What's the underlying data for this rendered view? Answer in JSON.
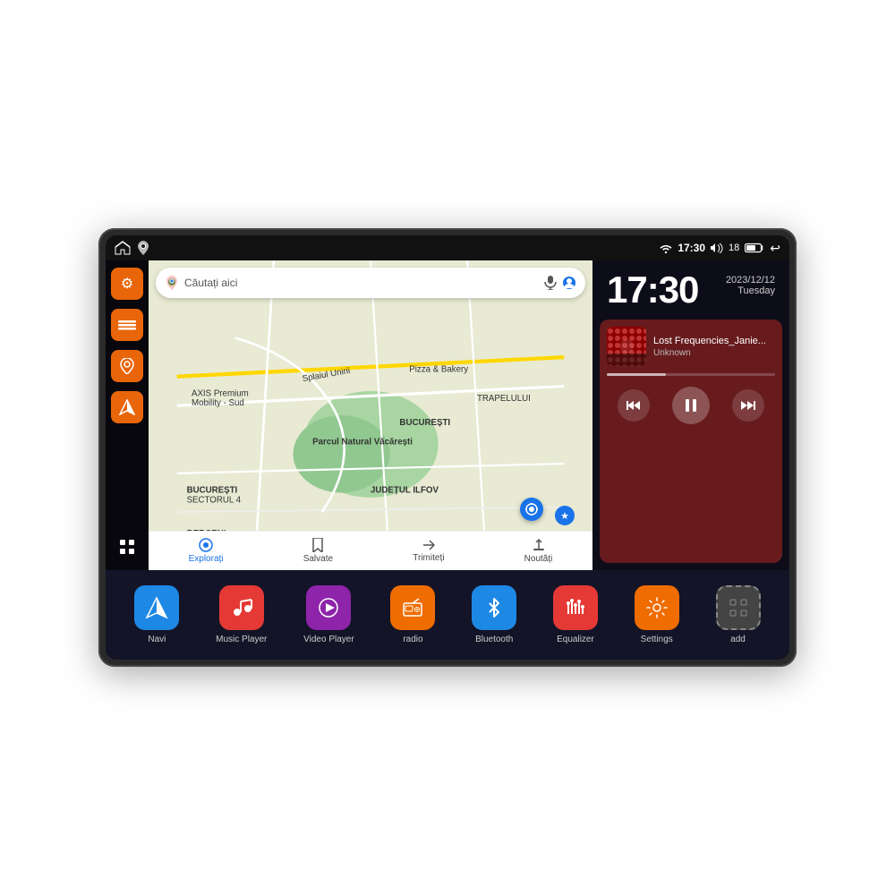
{
  "device": {
    "title": "Car Android Head Unit"
  },
  "status_bar": {
    "wifi_icon": "▼",
    "time": "17:30",
    "volume_icon": "🔊",
    "battery_level": "18",
    "battery_icon": "🔋",
    "back_icon": "↩"
  },
  "sidebar": {
    "icons": [
      {
        "id": "settings",
        "label": "Settings",
        "icon": "⚙",
        "color": "orange"
      },
      {
        "id": "files",
        "label": "Files",
        "icon": "≡",
        "color": "orange"
      },
      {
        "id": "maps",
        "label": "Maps",
        "icon": "📍",
        "color": "orange"
      },
      {
        "id": "navigation",
        "label": "Navigation",
        "icon": "▲",
        "color": "orange"
      }
    ],
    "dots_icon": "⠿"
  },
  "map": {
    "search_placeholder": "Căutați aici",
    "bottom_items": [
      {
        "id": "explore",
        "label": "Explorați",
        "icon": "🔍",
        "active": true
      },
      {
        "id": "saved",
        "label": "Salvate",
        "icon": "🔖",
        "active": false
      },
      {
        "id": "share",
        "label": "Trimiteți",
        "icon": "↗",
        "active": false
      },
      {
        "id": "news",
        "label": "Noutăți",
        "icon": "🔔",
        "active": false
      }
    ],
    "places": [
      "AXIS Premium Mobility - Sud",
      "Parcul Natural Văcărești",
      "Pizza & Bakery",
      "BUCURESTI SECTORUL 4",
      "BERCENI",
      "JUDETUL ILFOV",
      "TRAPELULUI"
    ]
  },
  "clock": {
    "time": "17:30",
    "date": "2023/12/12",
    "day": "Tuesday"
  },
  "music_player": {
    "track_name": "Lost Frequencies_Janie...",
    "artist": "Unknown",
    "prev_icon": "⏮",
    "pause_icon": "⏸",
    "next_icon": "⏭"
  },
  "apps": [
    {
      "id": "navi",
      "label": "Navi",
      "icon": "▲",
      "bg": "#1e88e5"
    },
    {
      "id": "music",
      "label": "Music Player",
      "icon": "♪",
      "bg": "#e53935"
    },
    {
      "id": "video",
      "label": "Video Player",
      "icon": "▶",
      "bg": "#8e24aa"
    },
    {
      "id": "radio",
      "label": "radio",
      "icon": "📻",
      "bg": "#ef6c00"
    },
    {
      "id": "bluetooth",
      "label": "Bluetooth",
      "icon": "⚡",
      "bg": "#1e88e5"
    },
    {
      "id": "equalizer",
      "label": "Equalizer",
      "icon": "≋",
      "bg": "#e53935"
    },
    {
      "id": "settings",
      "label": "Settings",
      "icon": "⚙",
      "bg": "#ef6c00"
    },
    {
      "id": "add",
      "label": "add",
      "icon": "+",
      "bg": "#555"
    }
  ],
  "colors": {
    "bg_dark": "#0d0d1a",
    "sidebar_bg": "rgba(0,0,0,0.7)",
    "orange": "#e8650a",
    "music_bg": "rgba(120,30,30,0.85)"
  }
}
